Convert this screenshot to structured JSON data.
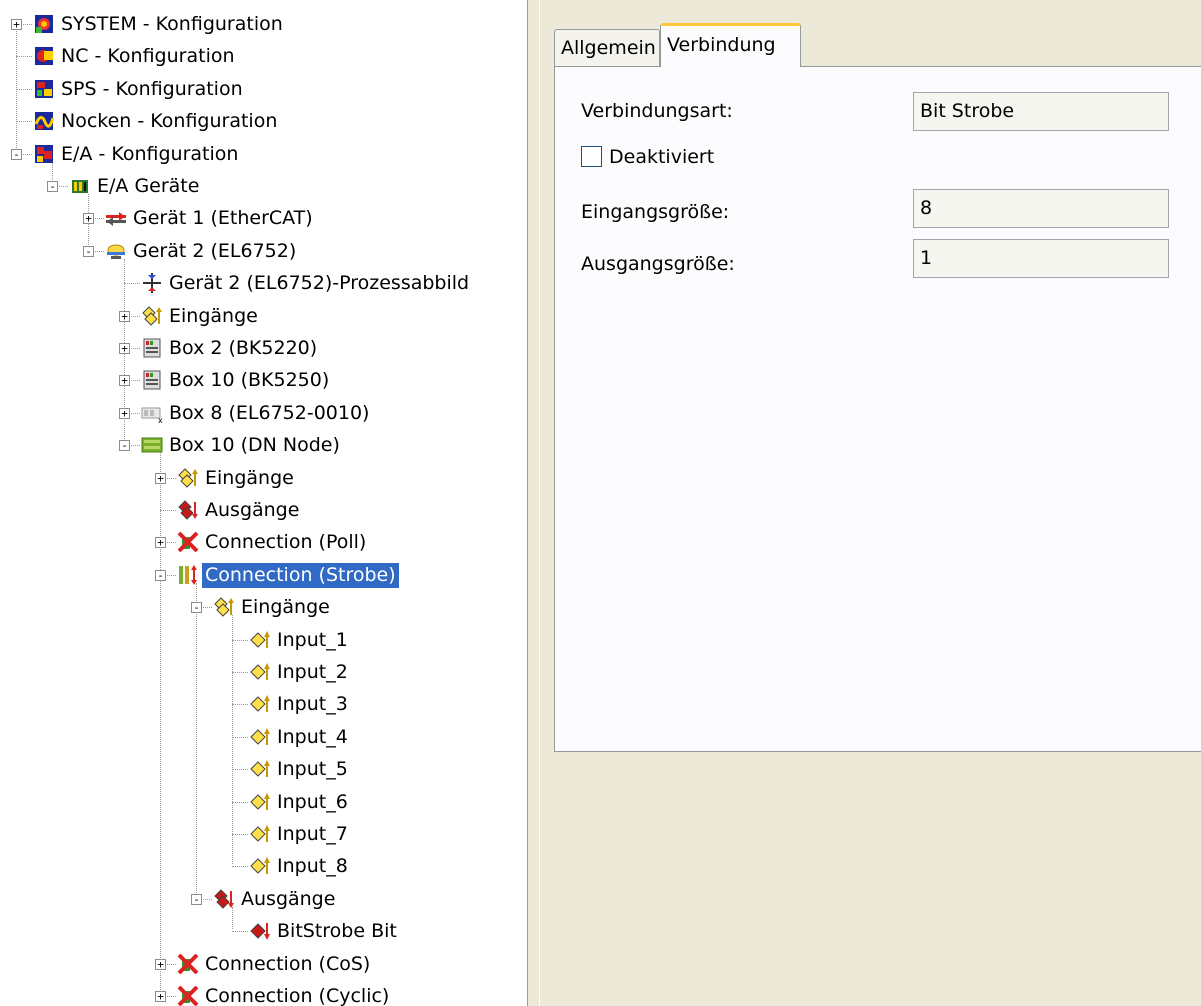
{
  "tree": {
    "nodes": [
      {
        "label": "SYSTEM - Konfiguration",
        "icon": "system-icon",
        "level": 0,
        "expander": "+"
      },
      {
        "label": "NC - Konfiguration",
        "icon": "nc-icon",
        "level": 0,
        "expander": ""
      },
      {
        "label": "SPS - Konfiguration",
        "icon": "plc-icon",
        "level": 0,
        "expander": ""
      },
      {
        "label": "Nocken - Konfiguration",
        "icon": "cam-icon",
        "level": 0,
        "expander": ""
      },
      {
        "label": "E/A - Konfiguration",
        "icon": "io-config-icon",
        "level": 0,
        "expander": "-"
      },
      {
        "label": "E/A Geräte",
        "icon": "io-devices-icon",
        "level": 1,
        "expander": "-"
      },
      {
        "label": "Gerät 1 (EtherCAT)",
        "icon": "ethercat-device-icon",
        "level": 2,
        "expander": "+"
      },
      {
        "label": "Gerät 2 (EL6752)",
        "icon": "devicenet-device-icon",
        "level": 2,
        "expander": "-"
      },
      {
        "label": "Gerät 2 (EL6752)-Prozessabbild",
        "icon": "process-image-icon",
        "level": 3,
        "expander": ""
      },
      {
        "label": "Eingänge",
        "icon": "inputs-icon",
        "level": 3,
        "expander": "+"
      },
      {
        "label": "Box 2  (BK5220)",
        "icon": "bus-coupler-icon",
        "level": 3,
        "expander": "+"
      },
      {
        "label": "Box 10  (BK5250)",
        "icon": "bus-coupler-icon",
        "level": 3,
        "expander": "+"
      },
      {
        "label": "Box 8 (EL6752-0010)",
        "icon": "box-slave-icon",
        "level": 3,
        "expander": "+"
      },
      {
        "label": "Box 10 (DN Node)",
        "icon": "dn-node-icon",
        "level": 3,
        "expander": "-"
      },
      {
        "label": "Eingänge",
        "icon": "inputs-icon",
        "level": 4,
        "expander": "+"
      },
      {
        "label": "Ausgänge",
        "icon": "outputs-icon",
        "level": 4,
        "expander": ""
      },
      {
        "label": "Connection (Poll)",
        "icon": "connection-disabled-icon",
        "level": 4,
        "expander": "+"
      },
      {
        "label": "Connection (Strobe)",
        "icon": "connection-active-icon",
        "level": 4,
        "expander": "-",
        "selected": true
      },
      {
        "label": "Eingänge",
        "icon": "inputs-icon",
        "level": 5,
        "expander": "-"
      },
      {
        "label": "Input_1",
        "icon": "input-var-icon",
        "level": 6,
        "expander": ""
      },
      {
        "label": "Input_2",
        "icon": "input-var-icon",
        "level": 6,
        "expander": ""
      },
      {
        "label": "Input_3",
        "icon": "input-var-icon",
        "level": 6,
        "expander": ""
      },
      {
        "label": "Input_4",
        "icon": "input-var-icon",
        "level": 6,
        "expander": ""
      },
      {
        "label": "Input_5",
        "icon": "input-var-icon",
        "level": 6,
        "expander": ""
      },
      {
        "label": "Input_6",
        "icon": "input-var-icon",
        "level": 6,
        "expander": ""
      },
      {
        "label": "Input_7",
        "icon": "input-var-icon",
        "level": 6,
        "expander": ""
      },
      {
        "label": "Input_8",
        "icon": "input-var-icon",
        "level": 6,
        "expander": ""
      },
      {
        "label": "Ausgänge",
        "icon": "outputs-icon",
        "level": 5,
        "expander": "-"
      },
      {
        "label": "BitStrobe Bit",
        "icon": "output-var-icon",
        "level": 6,
        "expander": ""
      },
      {
        "label": "Connection (CoS)",
        "icon": "connection-disabled-icon",
        "level": 4,
        "expander": "+"
      },
      {
        "label": "Connection (Cyclic)",
        "icon": "connection-disabled-icon",
        "level": 4,
        "expander": "+"
      }
    ]
  },
  "tabs": [
    {
      "label": "Allgemein",
      "active": false
    },
    {
      "label": "Verbindung",
      "active": true
    }
  ],
  "form": {
    "connection_type_label": "Verbindungsart:",
    "connection_type_value": "Bit Strobe",
    "deactivated_label": "Deaktiviert",
    "deactivated_checked": false,
    "input_size_label": "Eingangsgröße:",
    "input_size_value": "8",
    "output_size_label": "Ausgangsgröße:",
    "output_size_value": "1"
  },
  "colors": {
    "selection": "#316ac5",
    "panel_background": "#ece9d8",
    "active_tab_accent": "#ffc83c"
  }
}
